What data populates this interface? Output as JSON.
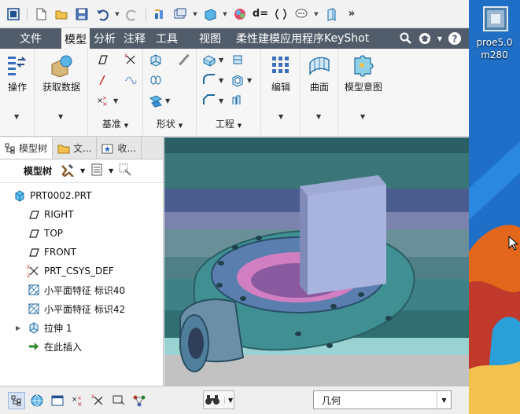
{
  "quick_access": {
    "more_label": "»",
    "relation_label": "d="
  },
  "menu": {
    "tabs": [
      "文件",
      "模型",
      "分析",
      "注释",
      "工具",
      "视图",
      "柔性建模",
      "应用程序",
      "KeyShot"
    ],
    "active": "模型"
  },
  "ribbon": {
    "operations": {
      "label": "操作"
    },
    "get_data": {
      "label": "获取数据"
    },
    "datum": {
      "label": "基准"
    },
    "shapes": {
      "label": "形状"
    },
    "engineering": {
      "label": "工程"
    },
    "edit": {
      "label": "编辑"
    },
    "surfaces": {
      "label": "曲面"
    },
    "model_intent": {
      "label": "模型意图"
    }
  },
  "panel": {
    "tabs": [
      {
        "label": "模型树",
        "active": true
      },
      {
        "label": "文..."
      },
      {
        "label": "收..."
      }
    ],
    "toolbar_title": "模型树",
    "tree": [
      {
        "label": "PRT0002.PRT",
        "icon": "part-icon"
      },
      {
        "label": "RIGHT",
        "icon": "datum-plane-icon"
      },
      {
        "label": "TOP",
        "icon": "datum-plane-icon"
      },
      {
        "label": "FRONT",
        "icon": "datum-plane-icon"
      },
      {
        "label": "PRT_CSYS_DEF",
        "icon": "csys-icon"
      },
      {
        "label": "小平面特征 标识40",
        "icon": "facet-feature-icon"
      },
      {
        "label": "小平面特征 标识42",
        "icon": "facet-feature-icon"
      },
      {
        "label": "拉伸 1",
        "icon": "extrude-icon",
        "expandable": true
      },
      {
        "label": "在此插入",
        "icon": "insert-here-icon"
      }
    ]
  },
  "statusbar": {
    "filter_value": "几何"
  },
  "desktop": {
    "icon_label_line1": "proe5.0",
    "icon_label_line2": "m280"
  },
  "colors": {
    "menubar": "#515c6a",
    "accent_blue": "#2f6fb8",
    "desktop": "#1f6fc7",
    "model_block": "#9ea9d4",
    "model_body": "#3f8f93"
  }
}
